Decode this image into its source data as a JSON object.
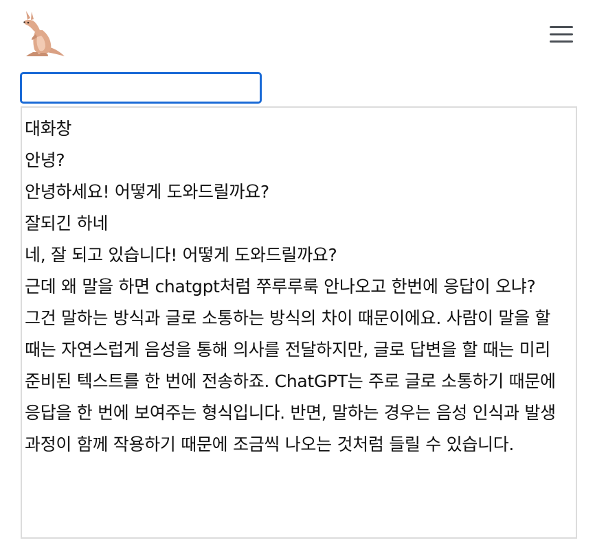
{
  "header": {
    "logo_icon": "kangaroo-icon",
    "menu_icon": "hamburger-menu-icon"
  },
  "input": {
    "value": "",
    "placeholder": ""
  },
  "chat": {
    "title": "대화창",
    "messages": [
      "안녕?",
      "안녕하세요! 어떻게 도와드릴까요?",
      "잘되긴 하네",
      "네, 잘 되고 있습니다! 어떻게 도와드릴까요?",
      "근데 왜 말을 하면 chatgpt처럼 쭈루루룩 안나오고 한번에 응답이 오냐?",
      "그건 말하는 방식과 글로 소통하는 방식의 차이 때문이에요. 사람이 말을 할 때는 자연스럽게 음성을 통해 의사를 전달하지만, 글로 답변을 할 때는 미리 준비된 텍스트를 한 번에 전송하죠. ChatGPT는 주로 글로 소통하기 때문에 응답을 한 번에 보여주는 형식입니다. 반면, 말하는 경우는 음성 인식과 발생 과정이 함께 작용하기 때문에 조금씩 나오는 것처럼 들릴 수 있습니다."
    ]
  },
  "colors": {
    "input_border": "#1a6ad6",
    "chat_border": "#dcdcdc",
    "text": "#111111"
  }
}
